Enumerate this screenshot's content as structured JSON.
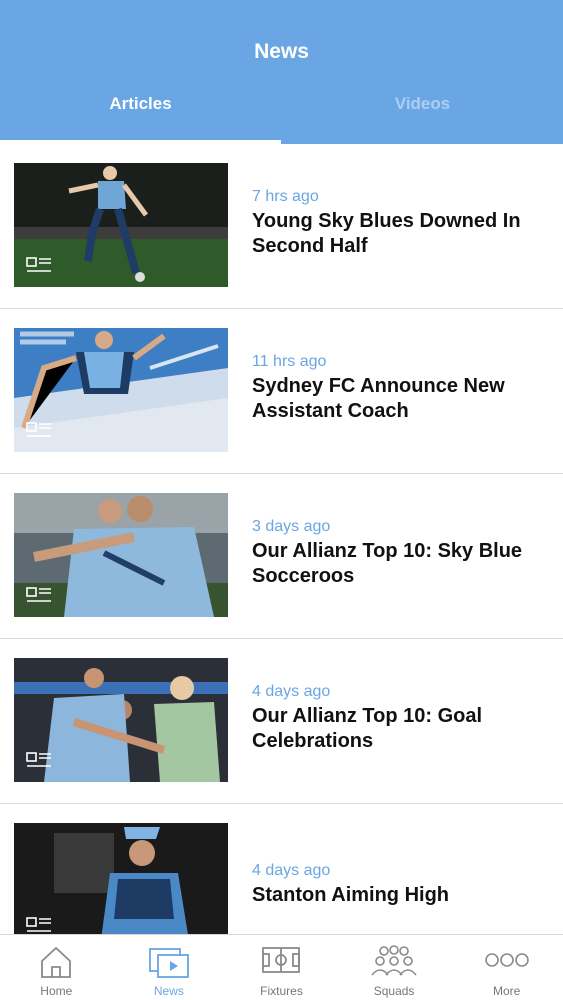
{
  "header": {
    "title": "News",
    "tabs": [
      {
        "label": "Articles",
        "active": true
      },
      {
        "label": "Videos",
        "active": false
      }
    ]
  },
  "articles": [
    {
      "time": "7 hrs ago",
      "title": "Young Sky Blues Downed In Second Half",
      "image_icon": "article-icon"
    },
    {
      "time": "11 hrs ago",
      "title": "Sydney FC Announce New Assistant Coach",
      "image_icon": "article-icon"
    },
    {
      "time": "3 days ago",
      "title": "Our Allianz Top 10: Sky Blue Socceroos",
      "image_icon": "article-icon"
    },
    {
      "time": "4 days ago",
      "title": "Our Allianz Top 10: Goal Celebrations",
      "image_icon": "article-icon"
    },
    {
      "time": "4 days ago",
      "title": "Stanton Aiming High",
      "image_icon": "article-icon"
    }
  ],
  "bottom_nav": [
    {
      "label": "Home",
      "icon": "home-icon",
      "active": false
    },
    {
      "label": "News",
      "icon": "news-icon",
      "active": true
    },
    {
      "label": "Fixtures",
      "icon": "pitch-icon",
      "active": false
    },
    {
      "label": "Squads",
      "icon": "squad-icon",
      "active": false
    },
    {
      "label": "More",
      "icon": "more-icon",
      "active": false
    }
  ],
  "colors": {
    "accent": "#6aa6e3",
    "header_bg": "#6aa6e3",
    "headline": "#111111",
    "inactive": "#777777"
  }
}
